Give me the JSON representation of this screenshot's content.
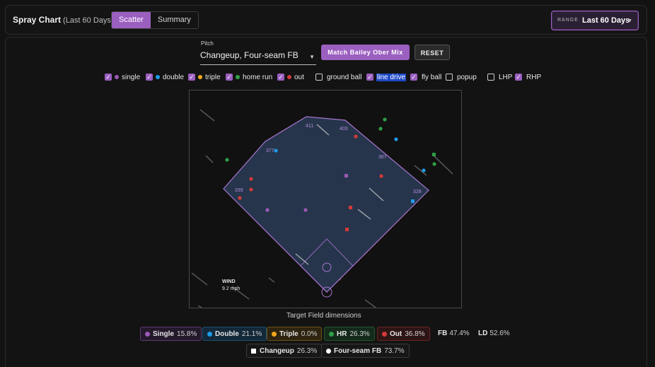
{
  "header": {
    "title": "Spray Chart",
    "subtitle": "(Last 60 Days)",
    "tabs": [
      {
        "label": "Scatter",
        "active": true
      },
      {
        "label": "Summary",
        "active": false
      }
    ],
    "range": {
      "label": "RANGE",
      "value": "Last 60 Days"
    }
  },
  "pitch": {
    "label": "Pitch",
    "value": "Changeup, Four-seam FB",
    "match_button": "Match Bailey Ober Mix",
    "reset_button": "RESET"
  },
  "filters": [
    {
      "label": "single",
      "checked": true,
      "color": "#9b59b6"
    },
    {
      "label": "double",
      "checked": true,
      "color": "#1e9be9"
    },
    {
      "label": "triple",
      "checked": true,
      "color": "#f0a81c"
    },
    {
      "label": "home run",
      "checked": true,
      "color": "#2e9e48"
    },
    {
      "label": "out",
      "checked": true,
      "color": "#d23a3a"
    },
    {
      "label": "ground ball",
      "checked": false
    },
    {
      "label": "line drive",
      "checked": true
    },
    {
      "label": "fly ball",
      "checked": true
    },
    {
      "label": "popup",
      "checked": false
    },
    {
      "label": "LHP",
      "checked": false
    },
    {
      "label": "RHP",
      "checked": true
    }
  ],
  "field": {
    "distances": {
      "lf": "339",
      "lcf": "377",
      "cf": "411",
      "rcf_top": "403",
      "rcf": "367",
      "rf": "328"
    },
    "wind": {
      "label": "WIND",
      "value": "9.2 mph"
    },
    "caption": "Target Field dimensions"
  },
  "summary": [
    {
      "label": "Single",
      "pct": "15.8%",
      "color": "#9b59b6"
    },
    {
      "label": "Double",
      "pct": "21.1%",
      "color": "#1e9be9"
    },
    {
      "label": "Triple",
      "pct": "0.0%",
      "color": "#f0a81c"
    },
    {
      "label": "HR",
      "pct": "26.3%",
      "color": "#2e9e48"
    },
    {
      "label": "Out",
      "pct": "36.8%",
      "color": "#d23a3a"
    }
  ],
  "batted": [
    {
      "label": "FB",
      "pct": "47.4%"
    },
    {
      "label": "LD",
      "pct": "52.6%"
    }
  ],
  "pitch_mix": [
    {
      "label": "Changeup",
      "pct": "26.3%"
    },
    {
      "label": "Four-seam FB",
      "pct": "73.7%"
    }
  ]
}
